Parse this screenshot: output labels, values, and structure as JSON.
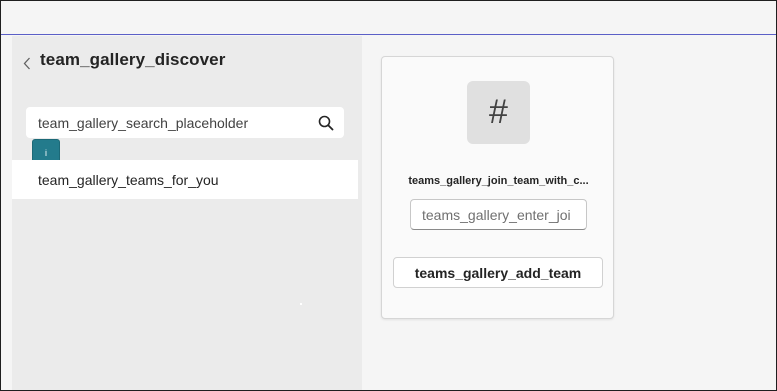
{
  "header": {
    "back_icon": "chevron-left-icon",
    "title": "team_gallery_discover"
  },
  "search": {
    "placeholder": "team_gallery_search_placeholder",
    "icon": "search-icon"
  },
  "badge": {
    "label": "i"
  },
  "sidebar": {
    "items": [
      {
        "label": "team_gallery_teams_for_you"
      }
    ]
  },
  "join_card": {
    "icon": "hash-icon",
    "icon_glyph": "#",
    "title": "teams_gallery_join_team_with_c...",
    "code_placeholder": "teams_gallery_enter_joi",
    "add_button_label": "teams_gallery_add_team"
  },
  "colors": {
    "accent_line": "#5b5fc7",
    "badge": "#237b8c"
  }
}
